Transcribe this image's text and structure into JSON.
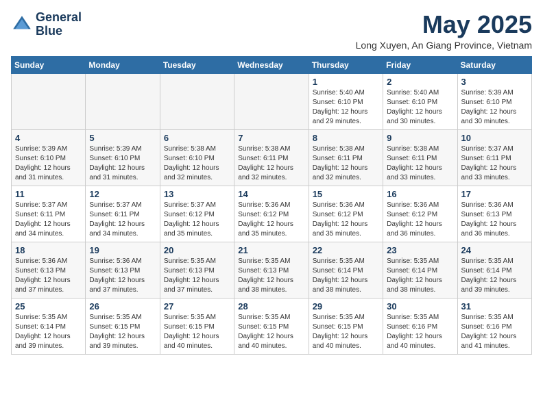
{
  "header": {
    "logo_line1": "General",
    "logo_line2": "Blue",
    "month_title": "May 2025",
    "location": "Long Xuyen, An Giang Province, Vietnam"
  },
  "weekdays": [
    "Sunday",
    "Monday",
    "Tuesday",
    "Wednesday",
    "Thursday",
    "Friday",
    "Saturday"
  ],
  "weeks": [
    [
      {
        "day": "",
        "info": "",
        "empty": true
      },
      {
        "day": "",
        "info": "",
        "empty": true
      },
      {
        "day": "",
        "info": "",
        "empty": true
      },
      {
        "day": "",
        "info": "",
        "empty": true
      },
      {
        "day": "1",
        "info": "Sunrise: 5:40 AM\nSunset: 6:10 PM\nDaylight: 12 hours\nand 29 minutes."
      },
      {
        "day": "2",
        "info": "Sunrise: 5:40 AM\nSunset: 6:10 PM\nDaylight: 12 hours\nand 30 minutes."
      },
      {
        "day": "3",
        "info": "Sunrise: 5:39 AM\nSunset: 6:10 PM\nDaylight: 12 hours\nand 30 minutes."
      }
    ],
    [
      {
        "day": "4",
        "info": "Sunrise: 5:39 AM\nSunset: 6:10 PM\nDaylight: 12 hours\nand 31 minutes."
      },
      {
        "day": "5",
        "info": "Sunrise: 5:39 AM\nSunset: 6:10 PM\nDaylight: 12 hours\nand 31 minutes."
      },
      {
        "day": "6",
        "info": "Sunrise: 5:38 AM\nSunset: 6:10 PM\nDaylight: 12 hours\nand 32 minutes."
      },
      {
        "day": "7",
        "info": "Sunrise: 5:38 AM\nSunset: 6:11 PM\nDaylight: 12 hours\nand 32 minutes."
      },
      {
        "day": "8",
        "info": "Sunrise: 5:38 AM\nSunset: 6:11 PM\nDaylight: 12 hours\nand 32 minutes."
      },
      {
        "day": "9",
        "info": "Sunrise: 5:38 AM\nSunset: 6:11 PM\nDaylight: 12 hours\nand 33 minutes."
      },
      {
        "day": "10",
        "info": "Sunrise: 5:37 AM\nSunset: 6:11 PM\nDaylight: 12 hours\nand 33 minutes."
      }
    ],
    [
      {
        "day": "11",
        "info": "Sunrise: 5:37 AM\nSunset: 6:11 PM\nDaylight: 12 hours\nand 34 minutes."
      },
      {
        "day": "12",
        "info": "Sunrise: 5:37 AM\nSunset: 6:11 PM\nDaylight: 12 hours\nand 34 minutes."
      },
      {
        "day": "13",
        "info": "Sunrise: 5:37 AM\nSunset: 6:12 PM\nDaylight: 12 hours\nand 35 minutes."
      },
      {
        "day": "14",
        "info": "Sunrise: 5:36 AM\nSunset: 6:12 PM\nDaylight: 12 hours\nand 35 minutes."
      },
      {
        "day": "15",
        "info": "Sunrise: 5:36 AM\nSunset: 6:12 PM\nDaylight: 12 hours\nand 35 minutes."
      },
      {
        "day": "16",
        "info": "Sunrise: 5:36 AM\nSunset: 6:12 PM\nDaylight: 12 hours\nand 36 minutes."
      },
      {
        "day": "17",
        "info": "Sunrise: 5:36 AM\nSunset: 6:13 PM\nDaylight: 12 hours\nand 36 minutes."
      }
    ],
    [
      {
        "day": "18",
        "info": "Sunrise: 5:36 AM\nSunset: 6:13 PM\nDaylight: 12 hours\nand 37 minutes."
      },
      {
        "day": "19",
        "info": "Sunrise: 5:36 AM\nSunset: 6:13 PM\nDaylight: 12 hours\nand 37 minutes."
      },
      {
        "day": "20",
        "info": "Sunrise: 5:35 AM\nSunset: 6:13 PM\nDaylight: 12 hours\nand 37 minutes."
      },
      {
        "day": "21",
        "info": "Sunrise: 5:35 AM\nSunset: 6:13 PM\nDaylight: 12 hours\nand 38 minutes."
      },
      {
        "day": "22",
        "info": "Sunrise: 5:35 AM\nSunset: 6:14 PM\nDaylight: 12 hours\nand 38 minutes."
      },
      {
        "day": "23",
        "info": "Sunrise: 5:35 AM\nSunset: 6:14 PM\nDaylight: 12 hours\nand 38 minutes."
      },
      {
        "day": "24",
        "info": "Sunrise: 5:35 AM\nSunset: 6:14 PM\nDaylight: 12 hours\nand 39 minutes."
      }
    ],
    [
      {
        "day": "25",
        "info": "Sunrise: 5:35 AM\nSunset: 6:14 PM\nDaylight: 12 hours\nand 39 minutes."
      },
      {
        "day": "26",
        "info": "Sunrise: 5:35 AM\nSunset: 6:15 PM\nDaylight: 12 hours\nand 39 minutes."
      },
      {
        "day": "27",
        "info": "Sunrise: 5:35 AM\nSunset: 6:15 PM\nDaylight: 12 hours\nand 40 minutes."
      },
      {
        "day": "28",
        "info": "Sunrise: 5:35 AM\nSunset: 6:15 PM\nDaylight: 12 hours\nand 40 minutes."
      },
      {
        "day": "29",
        "info": "Sunrise: 5:35 AM\nSunset: 6:15 PM\nDaylight: 12 hours\nand 40 minutes."
      },
      {
        "day": "30",
        "info": "Sunrise: 5:35 AM\nSunset: 6:16 PM\nDaylight: 12 hours\nand 40 minutes."
      },
      {
        "day": "31",
        "info": "Sunrise: 5:35 AM\nSunset: 6:16 PM\nDaylight: 12 hours\nand 41 minutes."
      }
    ]
  ]
}
